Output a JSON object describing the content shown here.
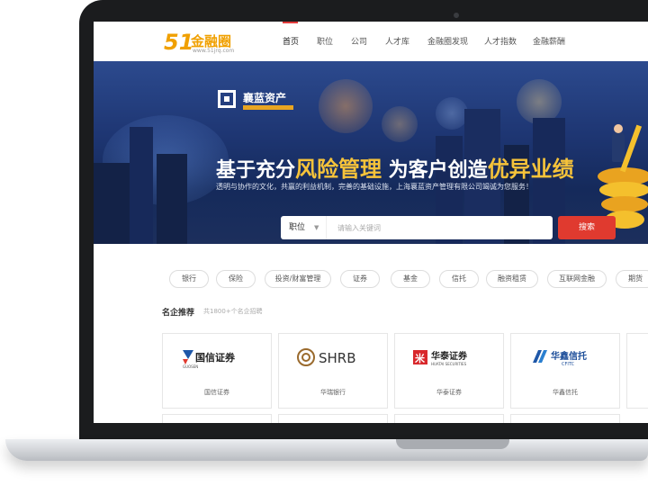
{
  "nav": {
    "logo_number": "51",
    "logo_name": "金融圈",
    "logo_url": "www.51jrq.com",
    "items": [
      {
        "label": "首页",
        "active": true
      },
      {
        "label": "职位"
      },
      {
        "label": "公司"
      },
      {
        "label": "人才库"
      },
      {
        "label": "金融圈发现"
      },
      {
        "label": "人才指数"
      },
      {
        "label": "金融薪酬"
      }
    ]
  },
  "banner": {
    "brand": "襄蓝资产",
    "headline_part1": "基于充分",
    "headline_highlight1": "风险管理",
    "headline_part2": " 为客户创造",
    "headline_highlight2": "优异业绩",
    "subline": "透明与协作的文化，共赢的利益机制，完善的基础设施，上海襄蓝资产管理有限公司竭诚为您服务！",
    "accent_color": "#f6c33a"
  },
  "search": {
    "select_label": "职位",
    "placeholder": "请输入关键词",
    "button_label": "搜索",
    "button_color": "#e03a2f"
  },
  "tags": [
    "银行",
    "保险",
    "投资/财富管理",
    "证券",
    "基金",
    "信托",
    "融资租赁",
    "互联网金融",
    "期货"
  ],
  "featured": {
    "title": "名企推荐",
    "subtitle": "共1800+个名企招聘",
    "companies": [
      {
        "logo_text": "国信证券",
        "logo_sub": "GUOSEN",
        "name": "国信证券"
      },
      {
        "logo_text": "SHRB",
        "name": "华瑞银行"
      },
      {
        "logo_text": "华泰证券",
        "logo_sub": "HUATAI SECURITIES",
        "name": "华泰证券"
      },
      {
        "logo_text": "华鑫信托",
        "logo_sub": "CFITC",
        "name": "华鑫信托"
      }
    ]
  }
}
